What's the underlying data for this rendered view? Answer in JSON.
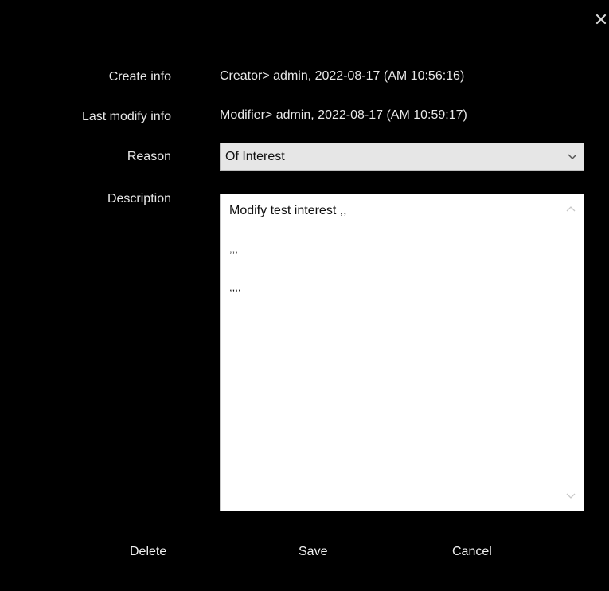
{
  "dialog": {
    "close_icon": "close-icon",
    "fields": {
      "create_info": {
        "label": "Create info",
        "value": "Creator> admin, 2022-08-17 (AM 10:56:16)"
      },
      "last_modify_info": {
        "label": "Last modify info",
        "value": "Modifier> admin, 2022-08-17 (AM 10:59:17)"
      },
      "reason": {
        "label": "Reason",
        "selected": "Of Interest",
        "chevron_icon": "chevron-down-icon"
      },
      "description": {
        "label": "Description",
        "lines": [
          "Modify test interest ,,",
          ",,,",
          ",,,,"
        ]
      }
    },
    "buttons": {
      "delete": "Delete",
      "save": "Save",
      "cancel": "Cancel"
    }
  },
  "colors": {
    "background": "#000000",
    "text": "#e8e8e8",
    "select_bg": "#e6e6e6",
    "textarea_bg": "#ffffff"
  }
}
